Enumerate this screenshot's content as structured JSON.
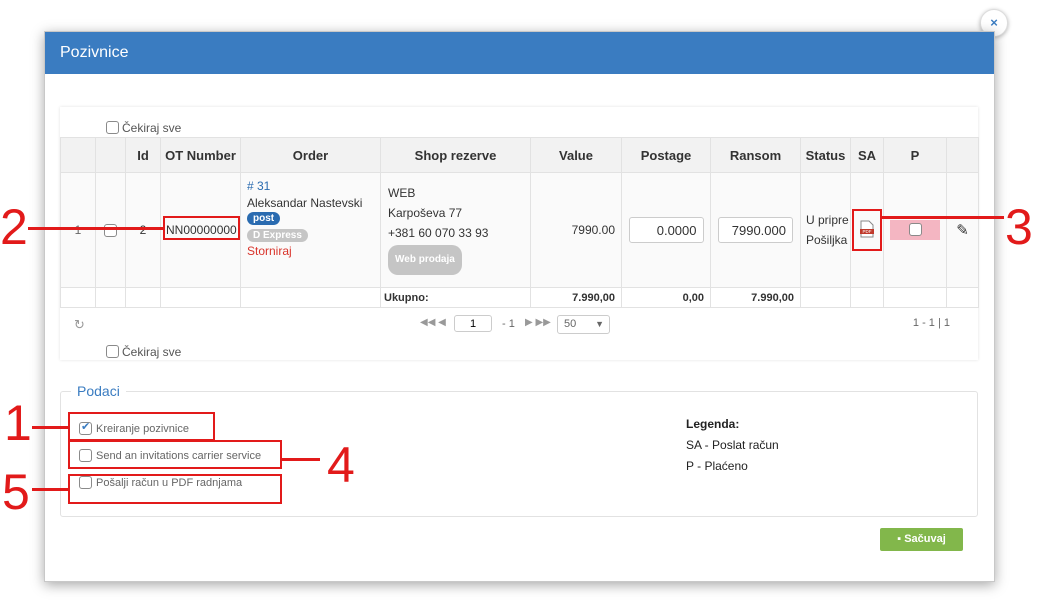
{
  "modal": {
    "title": "Pozivnice",
    "close": "×"
  },
  "grid": {
    "check_all": "Čekiraj sve",
    "columns": [
      "",
      "",
      "Id",
      "OT Number",
      "Order",
      "Shop rezerve",
      "Value",
      "Postage",
      "Ransom",
      "Status",
      "SA",
      "P",
      ""
    ],
    "row": {
      "index": "1",
      "id": "2",
      "ot_number": "NN00000000",
      "order_no": "# 31",
      "customer": "Aleksandar Nastevski",
      "badge_post": "post",
      "badge_courier": "D Express",
      "storno": "Storniraj",
      "shop_line1": "WEB",
      "shop_line2": "Karpoševa 77",
      "shop_line3": "+381 60 070 33 93",
      "shop_badge": "Web prodaja",
      "value": "7990.00",
      "postage": "0.0000",
      "ransom": "7990.000",
      "status_line1": "U pripre",
      "status_line2": "Pošiljka",
      "sa_icon": "pdf-icon"
    },
    "totals": {
      "label": "Ukupno:",
      "value": "7.990,00",
      "postage": "0,00",
      "ransom": "7.990,00"
    },
    "pager": {
      "page": "1",
      "of": "- 1",
      "page_size": "50",
      "info": "1 - 1 | 1"
    }
  },
  "podaci": {
    "title": "Podaci",
    "options": [
      {
        "label": "Kreiranje pozivnice",
        "checked": true
      },
      {
        "label": "Send an invitations carrier service",
        "checked": false
      },
      {
        "label": "Pošalji račun u PDF radnjama",
        "checked": false
      }
    ],
    "legend_title": "Legenda:",
    "legend_items": [
      "SA - Poslat račun",
      "P - Plaćeno"
    ]
  },
  "save_button": "Sačuvaj",
  "callouts": [
    "1",
    "2",
    "3",
    "4",
    "5"
  ],
  "colors": {
    "header": "#3a7cc1",
    "save": "#82b74b",
    "annotation": "#e21a1a",
    "paid_cell": "#f4b6c2"
  }
}
